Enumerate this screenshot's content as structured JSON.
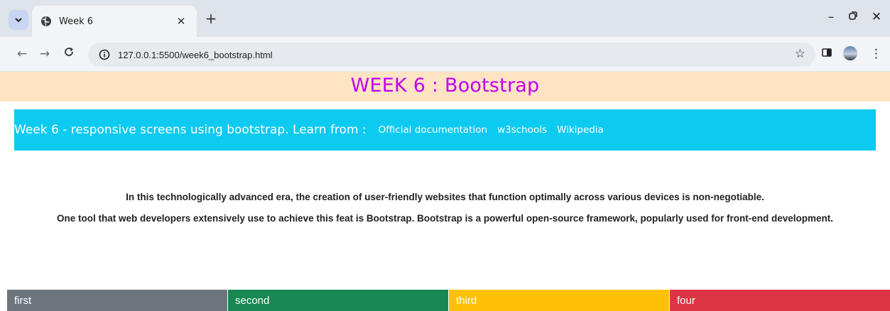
{
  "browser": {
    "tab_title": "Week 6",
    "url": "127.0.0.1:5500/week6_bootstrap.html"
  },
  "page": {
    "heading": "WEEK 6 : Bootstrap",
    "infobar": {
      "lead": "Week 6 - responsive screens using bootstrap. Learn from :",
      "links": [
        "Official documentation",
        "w3schools",
        "Wikipedia"
      ]
    },
    "paragraphs": [
      "In this technologically advanced era, the creation of user-friendly websites that function optimally across various devices is non-negotiable.",
      "One tool that web developers extensively use to achieve this feat is Bootstrap. Bootstrap is a powerful open-source framework, popularly used for front-end development."
    ],
    "columns": [
      {
        "label": "first",
        "color": "#6c757d"
      },
      {
        "label": "second",
        "color": "#198754"
      },
      {
        "label": "third",
        "color": "#ffc107"
      },
      {
        "label": "four",
        "color": "#dc3545"
      }
    ]
  },
  "icons": {
    "tab_menu": "chevron-down-icon",
    "favicon": "globe-icon",
    "tab_close": "close-icon",
    "new_tab": "plus-icon",
    "back": "arrow-left-icon",
    "forward": "arrow-right-icon",
    "reload": "reload-icon",
    "site_info": "info-icon",
    "bookmark": "star-icon",
    "side_panel": "side-panel-icon",
    "profile": "avatar",
    "menu": "kebab-menu-icon"
  },
  "colors": {
    "header_bg": "#ffe4c4",
    "heading_text": "#c200f2",
    "infobar_bg": "#0dcaf0"
  }
}
